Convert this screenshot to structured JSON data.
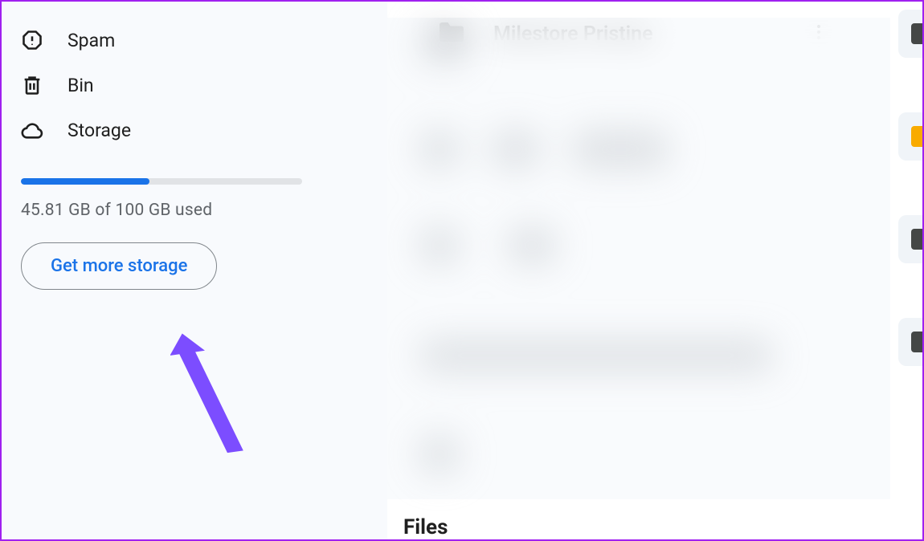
{
  "sidebar": {
    "items": [
      {
        "label": "Spam",
        "icon": "spam-icon"
      },
      {
        "label": "Bin",
        "icon": "bin-icon"
      },
      {
        "label": "Storage",
        "icon": "cloud-icon"
      }
    ],
    "storage": {
      "used_label": "45.81 GB of 100 GB used",
      "percent": 45.81,
      "button_label": "Get more storage"
    }
  },
  "main": {
    "folder_name": "Milestore Pristine",
    "section_heading": "Files",
    "right_strip_chips": [
      {
        "color": "#444746"
      },
      {
        "color": "#f9ab00"
      },
      {
        "color": "#444746"
      },
      {
        "color": "#444746"
      },
      {
        "color": "#444746"
      }
    ]
  },
  "colors": {
    "accent": "#1a73e8",
    "annotation": "#7c4dff"
  }
}
